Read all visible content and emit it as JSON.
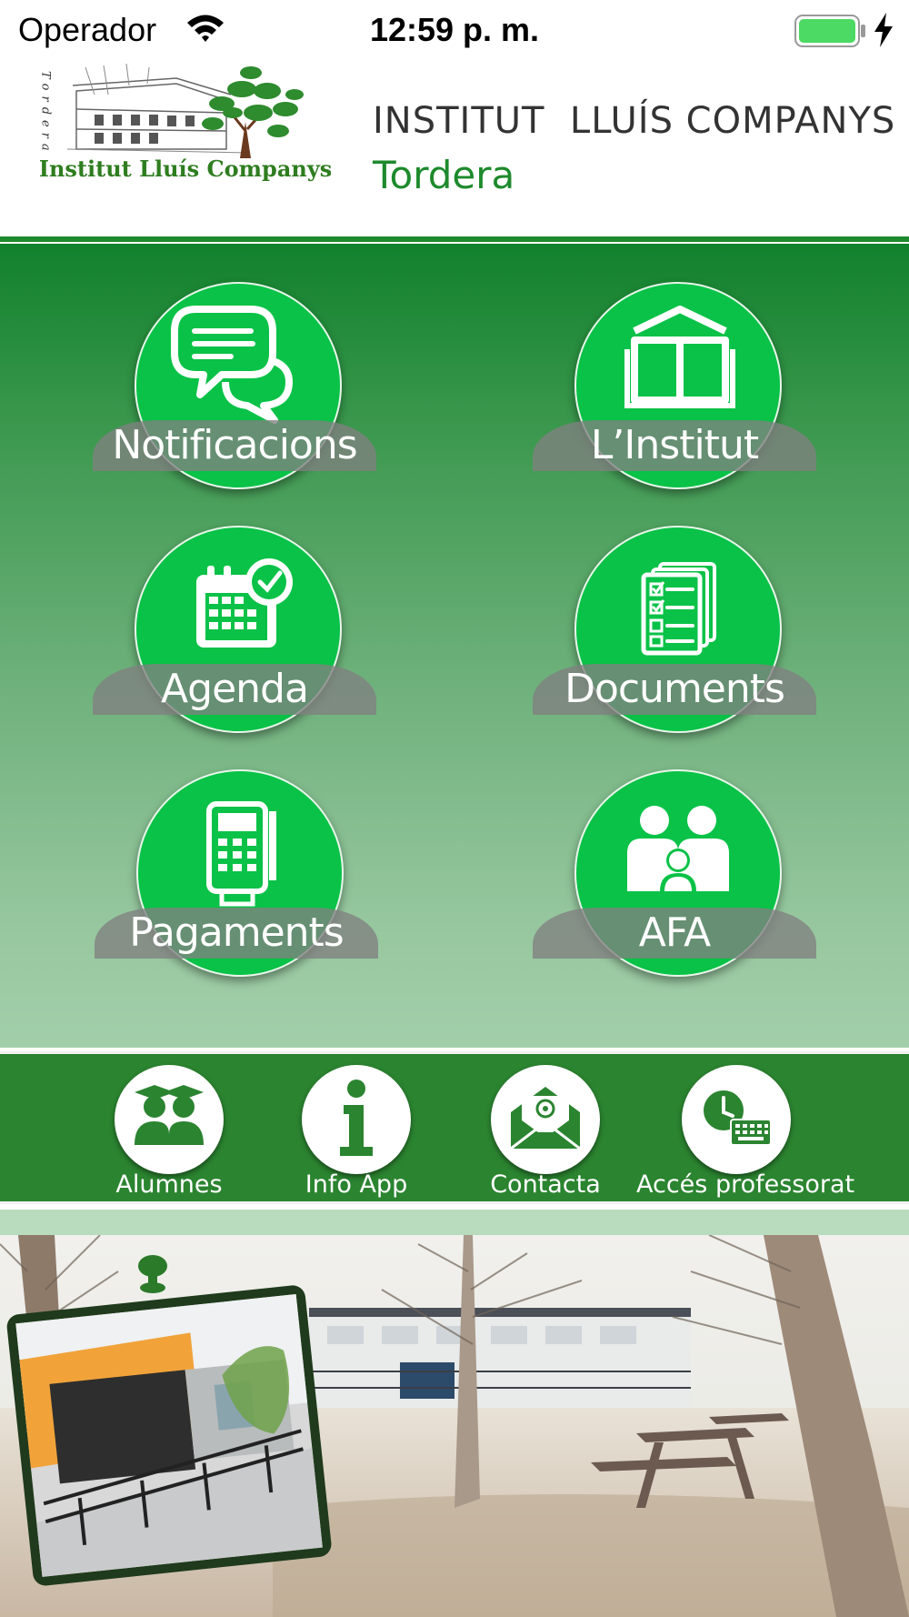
{
  "status_bar": {
    "carrier": "Operador",
    "time": "12:59 p. m."
  },
  "header": {
    "logo_text": "Institut Lluís Companys",
    "logo_vertical_text": "Tordera",
    "school_name": "INSTITUT  LLUÍS COMPANYS",
    "town": "Tordera"
  },
  "tiles": [
    {
      "label": "Notificacions",
      "icon": "chat-bubbles-icon"
    },
    {
      "label": "L’Institut",
      "icon": "open-book-house-icon"
    },
    {
      "label": "Agenda",
      "icon": "calendar-clock-icon"
    },
    {
      "label": "Documents",
      "icon": "checklist-documents-icon"
    },
    {
      "label": "Pagaments",
      "icon": "card-terminal-icon"
    },
    {
      "label": "AFA",
      "icon": "family-icon"
    }
  ],
  "quick_actions": [
    {
      "label": "Alumnes",
      "icon": "graduates-icon"
    },
    {
      "label": "Info App",
      "icon": "info-icon"
    },
    {
      "label": "Contacta",
      "icon": "email-envelope-icon"
    },
    {
      "label": "Accés professorat",
      "icon": "clock-keyboard-icon"
    }
  ],
  "colors": {
    "brand_green": "#1d8a2c",
    "tile_green": "#09c247",
    "bar_green": "#2b8430",
    "banner_gray": "#808080"
  }
}
